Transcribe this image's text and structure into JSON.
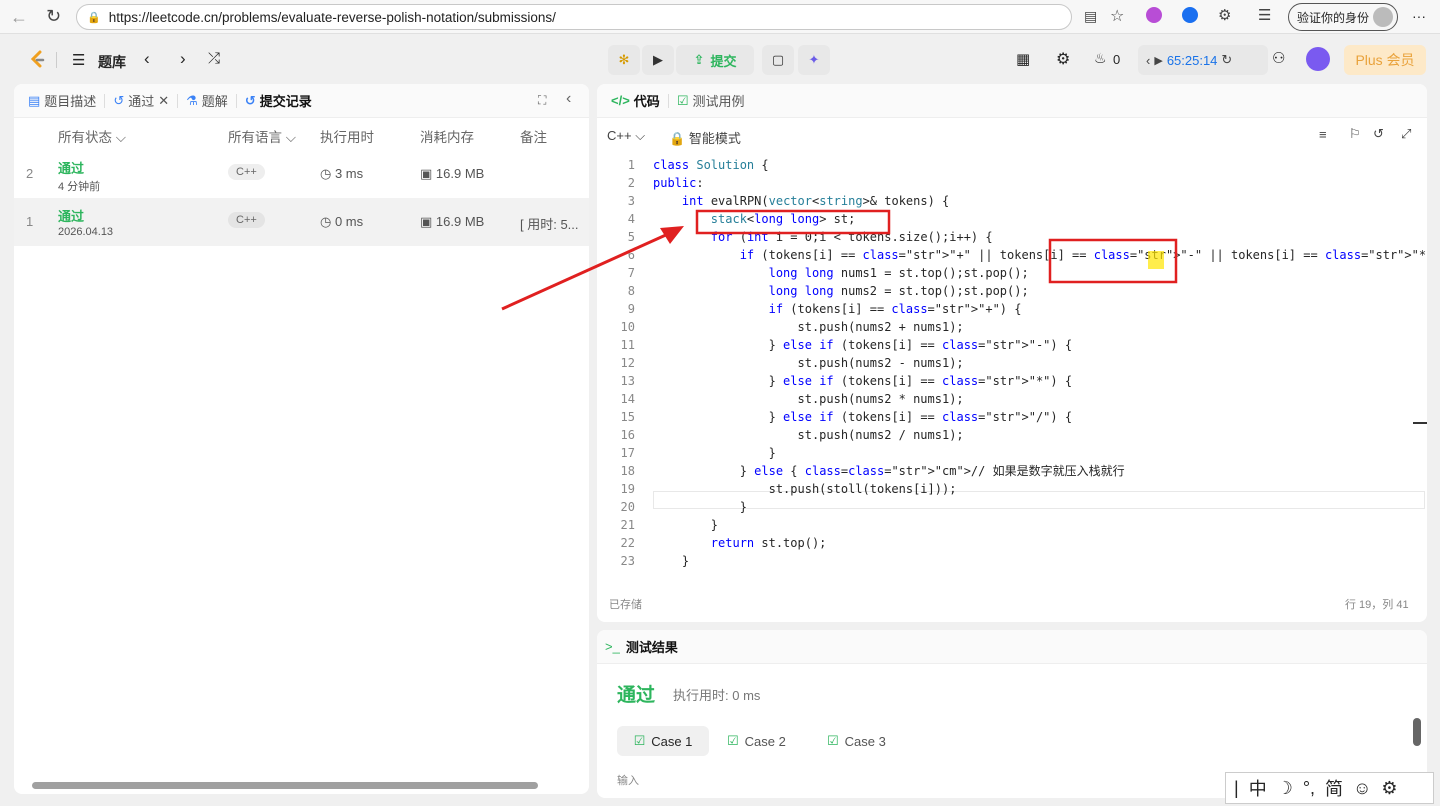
{
  "browser": {
    "url": "https://leetcode.cn/problems/evaluate-reverse-polish-notation/submissions/",
    "verify_label": "验证你的身份",
    "more": "···"
  },
  "topbar": {
    "problemset": "题库",
    "submit": "提交",
    "fire_count": "0",
    "timer": "65:25:14",
    "plus": "Plus 会员"
  },
  "left": {
    "tabs": {
      "desc": "题目描述",
      "passed": "通过",
      "solution": "题解",
      "submissions": "提交记录"
    },
    "headers": {
      "status": "所有状态",
      "lang": "所有语言",
      "time": "执行用时",
      "mem": "消耗内存",
      "note": "备注"
    },
    "rows": [
      {
        "idx": "2",
        "status": "通过",
        "date": "4 分钟前",
        "lang": "C++",
        "time": "3 ms",
        "mem": "16.9 MB",
        "note": ""
      },
      {
        "idx": "1",
        "status": "通过",
        "date": "2026.04.13",
        "lang": "C++",
        "time": "0 ms",
        "mem": "16.9 MB",
        "note": "[ 用时: 5..."
      }
    ]
  },
  "editor": {
    "tabs": {
      "code": "代码",
      "testcase": "测试用例"
    },
    "lang": "C++",
    "mode": "智能模式",
    "saved": "已存储",
    "cursor": "行 19，列 41",
    "lines": [
      {
        "n": "1",
        "t": "class Solution {"
      },
      {
        "n": "2",
        "t": "public:"
      },
      {
        "n": "3",
        "t": "    int evalRPN(vector<string>& tokens) {"
      },
      {
        "n": "4",
        "t": "        stack<long long> st;"
      },
      {
        "n": "5",
        "t": "        for (int i = 0;i < tokens.size();i++) {"
      },
      {
        "n": "6",
        "t": "            if (tokens[i] == \"+\" || tokens[i] == \"-\" || tokens[i] == \"*\" || tokens[i] == \"/\") {"
      },
      {
        "n": "7",
        "t": "                long long nums1 = st.top();st.pop();"
      },
      {
        "n": "8",
        "t": "                long long nums2 = st.top();st.pop();"
      },
      {
        "n": "9",
        "t": "                if (tokens[i] == \"+\") {"
      },
      {
        "n": "10",
        "t": "                    st.push(nums2 + nums1);"
      },
      {
        "n": "11",
        "t": "                } else if (tokens[i] == \"-\") {"
      },
      {
        "n": "12",
        "t": "                    st.push(nums2 - nums1);"
      },
      {
        "n": "13",
        "t": "                } else if (tokens[i] == \"*\") {"
      },
      {
        "n": "14",
        "t": "                    st.push(nums2 * nums1);"
      },
      {
        "n": "15",
        "t": "                } else if (tokens[i] == \"/\") {"
      },
      {
        "n": "16",
        "t": "                    st.push(nums2 / nums1);"
      },
      {
        "n": "17",
        "t": "                }"
      },
      {
        "n": "18",
        "t": "            } else { // 如果是数字就压入栈就行"
      },
      {
        "n": "19",
        "t": "                st.push(stoll(tokens[i]));"
      },
      {
        "n": "20",
        "t": "            }"
      },
      {
        "n": "21",
        "t": "        }"
      },
      {
        "n": "22",
        "t": "        return st.top();"
      },
      {
        "n": "23",
        "t": "    }"
      }
    ]
  },
  "result": {
    "title": "测试结果",
    "status": "通过",
    "runtime": "执行用时: 0 ms",
    "cases": [
      "Case 1",
      "Case 2",
      "Case 3"
    ],
    "input_label": "输入"
  },
  "ime": {
    "a": "中",
    "b": "简",
    "c": "°,"
  },
  "colors": {
    "accent": "#2db55d",
    "highlight_box": "#e02020",
    "yellow": "#ffe600"
  }
}
